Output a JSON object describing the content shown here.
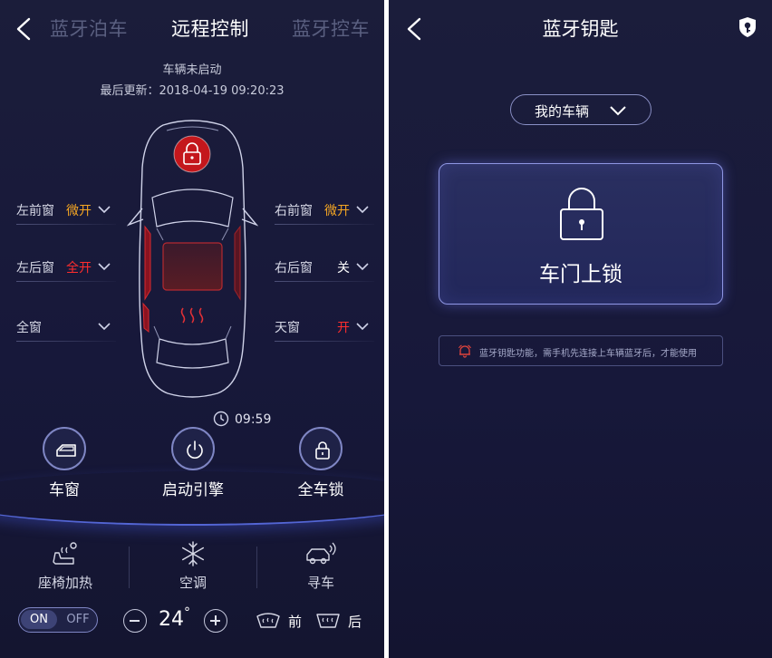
{
  "left": {
    "nav": {
      "tab_left": "蓝牙泊车",
      "tab_center": "远程控制",
      "tab_right": "蓝牙控车"
    },
    "status": {
      "engine": "车辆未启动",
      "last_update": "最后更新：2018-04-19    09:20:23"
    },
    "windows": {
      "front_left": {
        "label": "左前窗",
        "value": "微开"
      },
      "front_right": {
        "label": "右前窗",
        "value": "微开"
      },
      "rear_left": {
        "label": "左后窗",
        "value": "全开"
      },
      "rear_right": {
        "label": "右后窗",
        "value": "关"
      },
      "all": {
        "label": "全窗",
        "value": ""
      },
      "sunroof": {
        "label": "天窗",
        "value": "开"
      }
    },
    "timer": "09:59",
    "actions": {
      "window": "车窗",
      "engine": "启动引擎",
      "lock_all": "全车锁"
    },
    "features": {
      "seat_heat": "座椅加热",
      "ac": "空调",
      "find_car": "寻车"
    },
    "climate": {
      "on": "ON",
      "off": "OFF",
      "temperature": "24",
      "degree": "°",
      "front_defrost": "前",
      "rear_defrost": "后"
    },
    "colors": {
      "orange": "#f5a623",
      "red": "#ff2d2d",
      "lock_red": "#c4171c"
    }
  },
  "right": {
    "title": "蓝牙钥匙",
    "vehicle_select": "我的车辆",
    "lock_label": "车门上锁",
    "notice": "蓝牙钥匙功能，需手机先连接上车辆蓝牙后，才能使用"
  }
}
